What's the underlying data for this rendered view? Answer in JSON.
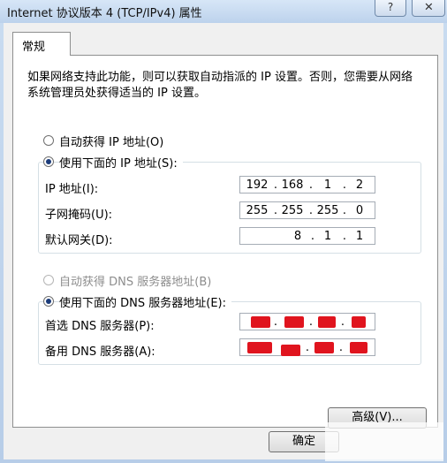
{
  "window": {
    "title": "Internet 协议版本 4 (TCP/IPv4) 属性",
    "help_symbol": "?",
    "close_symbol": "+"
  },
  "tab": {
    "label": "常规"
  },
  "description": "如果网络支持此功能，则可以获取自动指派的 IP 设置。否则，您需要从网络系统管理员处获得适当的 IP 设置。",
  "ip_section": {
    "auto_label": "自动获得 IP 地址(O)",
    "manual_label": "使用下面的 IP 地址(S):",
    "selected": "manual",
    "fields": [
      {
        "label": "IP 地址(I):",
        "octets": [
          "192",
          "168",
          "1",
          "2"
        ]
      },
      {
        "label": "子网掩码(U):",
        "octets": [
          "255",
          "255",
          "255",
          "0"
        ]
      },
      {
        "label": "默认网关(D):",
        "octets": [
          "",
          "",
          "8",
          ".1",
          "1"
        ]
      }
    ],
    "gateway_visible": [
      "8",
      "1",
      "1"
    ]
  },
  "dns_section": {
    "auto_label": "自动获得 DNS 服务器地址(B)",
    "auto_enabled": false,
    "manual_label": "使用下面的 DNS 服务器地址(E):",
    "selected": "manual",
    "fields": [
      {
        "label": "首选 DNS 服务器(P):",
        "redacted": true
      },
      {
        "label": "备用 DNS 服务器(A):",
        "redacted": true
      }
    ],
    "redaction_color": "#e0141e"
  },
  "buttons": {
    "advanced_label": "高级(V)...",
    "ok_label": "确定"
  }
}
